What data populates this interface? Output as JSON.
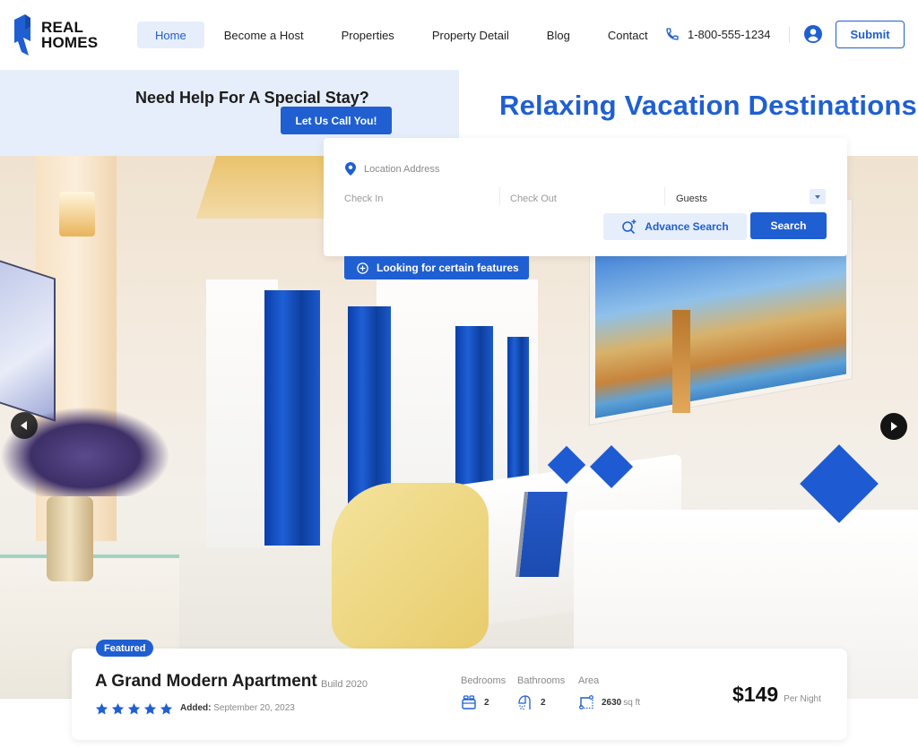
{
  "brand": {
    "line1": "REAL",
    "line2": "HOMES",
    "accent_color": "#1f5fd1"
  },
  "nav": {
    "items": [
      {
        "label": "Home",
        "active": true
      },
      {
        "label": "Become a Host",
        "active": false
      },
      {
        "label": "Properties",
        "active": false
      },
      {
        "label": "Property Detail",
        "active": false
      },
      {
        "label": "Blog",
        "active": false
      },
      {
        "label": "Contact",
        "active": false
      }
    ],
    "phone": "1-800-555-1234",
    "user_icon": "user-circle-icon",
    "submit_label": "Submit"
  },
  "help": {
    "title": "Need Help For A Special Stay?",
    "button_label": "Let Us Call You!"
  },
  "hero": {
    "title": "Relaxing Vacation Destinations",
    "prev_icon": "chevron-left-icon",
    "next_icon": "chevron-right-icon"
  },
  "search": {
    "location_placeholder": "Location Address",
    "checkin_placeholder": "Check In",
    "checkout_placeholder": "Check Out",
    "guests_value": "Guests",
    "advance_label": "Advance Search",
    "search_label": "Search",
    "features_label": "Looking for certain features"
  },
  "property": {
    "badge": "Featured",
    "title": "A Grand Modern Apartment",
    "build": "Build 2020",
    "rating": 5,
    "added_label": "Added:",
    "added_date": "September 20, 2023",
    "bedrooms_label": "Bedrooms",
    "bedrooms": "2",
    "bathrooms_label": "Bathrooms",
    "bathrooms": "2",
    "area_label": "Area",
    "area": "2630",
    "area_unit": "sq ft",
    "price": "$149",
    "price_unit": "Per Night"
  }
}
